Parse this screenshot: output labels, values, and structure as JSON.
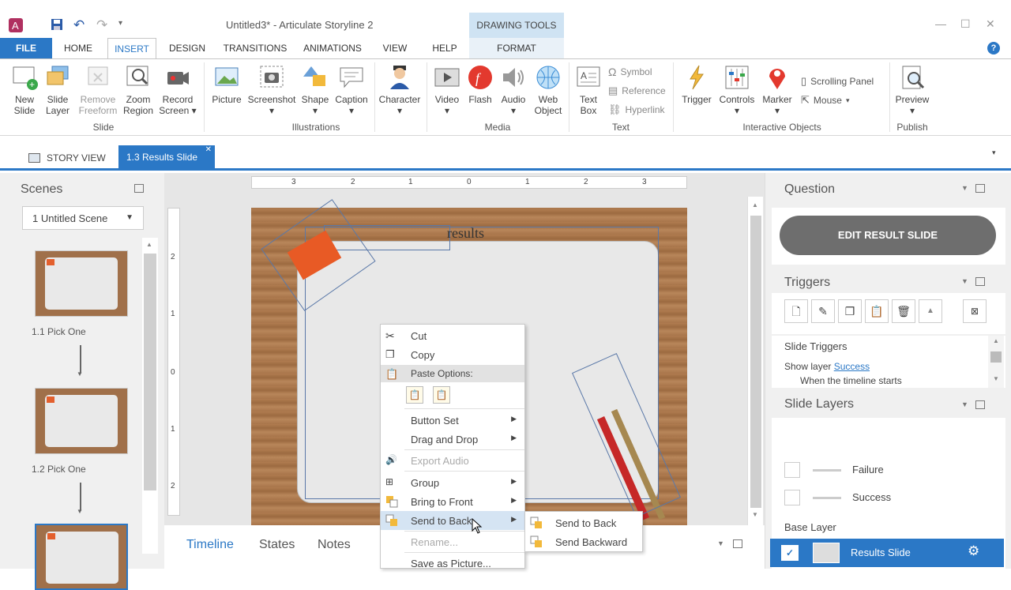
{
  "titlebar": {
    "title": "Untitled3* - Articulate Storyline 2",
    "contextual_group": "DRAWING TOOLS"
  },
  "tabs": [
    "FILE",
    "HOME",
    "INSERT",
    "DESIGN",
    "TRANSITIONS",
    "ANIMATIONS",
    "VIEW",
    "HELP",
    "FORMAT"
  ],
  "ribbon": {
    "groups": {
      "slide": "Slide",
      "illustrations": "Illustrations",
      "media": "Media",
      "text": "Text",
      "interactive": "Interactive Objects",
      "publish": "Publish"
    },
    "buttons": {
      "new_slide": [
        "New",
        "Slide"
      ],
      "slide_layer": [
        "Slide",
        "Layer"
      ],
      "remove_freeform": [
        "Remove",
        "Freeform"
      ],
      "zoom_region": [
        "Zoom",
        "Region"
      ],
      "record_screen": [
        "Record",
        "Screen"
      ],
      "picture": "Picture",
      "screenshot": "Screenshot",
      "shape": "Shape",
      "caption": "Caption",
      "character": "Character",
      "video": "Video",
      "flash": "Flash",
      "audio": "Audio",
      "web_object": [
        "Web",
        "Object"
      ],
      "text_box": [
        "Text",
        "Box"
      ],
      "symbol": "Symbol",
      "reference": "Reference",
      "hyperlink": "Hyperlink",
      "trigger": "Trigger",
      "controls": "Controls",
      "marker": "Marker",
      "scrolling_panel": "Scrolling Panel",
      "mouse": "Mouse",
      "preview": "Preview"
    }
  },
  "doc_tabs": {
    "story_view": "STORY VIEW",
    "current": "1.3 Results Slide"
  },
  "scenes": {
    "title": "Scenes",
    "selected_scene": "1 Untitled Scene",
    "slides": [
      "1.1 Pick One",
      "1.2 Pick One"
    ]
  },
  "stage": {
    "ruler_labels": [
      "3",
      "2",
      "1",
      "0",
      "1",
      "2",
      "3"
    ],
    "vruler_labels": [
      "2",
      "1",
      "0",
      "1",
      "2"
    ],
    "results_text": "results"
  },
  "bottom_tabs": [
    "Timeline",
    "States",
    "Notes"
  ],
  "right": {
    "question_title": "Question",
    "edit_result_button": "EDIT RESULT SLIDE",
    "triggers_title": "Triggers",
    "slide_triggers_label": "Slide Triggers",
    "show_layer_text": "Show layer",
    "show_layer_link": "Success",
    "when_text": "When the timeline starts",
    "slide_layers_title": "Slide Layers",
    "layers": [
      "Failure",
      "Success"
    ],
    "base_layer_label": "Base Layer",
    "base_layer_name": "Results Slide"
  },
  "context_menu": {
    "items": [
      {
        "label": "Cut",
        "icon": "cut-icon"
      },
      {
        "label": "Copy",
        "icon": "copy-icon"
      },
      {
        "label": "Paste Options:",
        "icon": "paste-icon"
      },
      {
        "label": "Button Set",
        "icon": ""
      },
      {
        "label": "Drag and Drop",
        "icon": ""
      },
      {
        "label": "Export Audio",
        "icon": "audio-icon"
      },
      {
        "label": "Group",
        "icon": "group-icon"
      },
      {
        "label": "Bring to Front",
        "icon": "bring-front-icon"
      },
      {
        "label": "Send to Back",
        "icon": "send-back-icon"
      },
      {
        "label": "Rename...",
        "icon": ""
      },
      {
        "label": "Save as Picture...",
        "icon": ""
      }
    ],
    "submenu": [
      "Send to Back",
      "Send Backward"
    ]
  }
}
